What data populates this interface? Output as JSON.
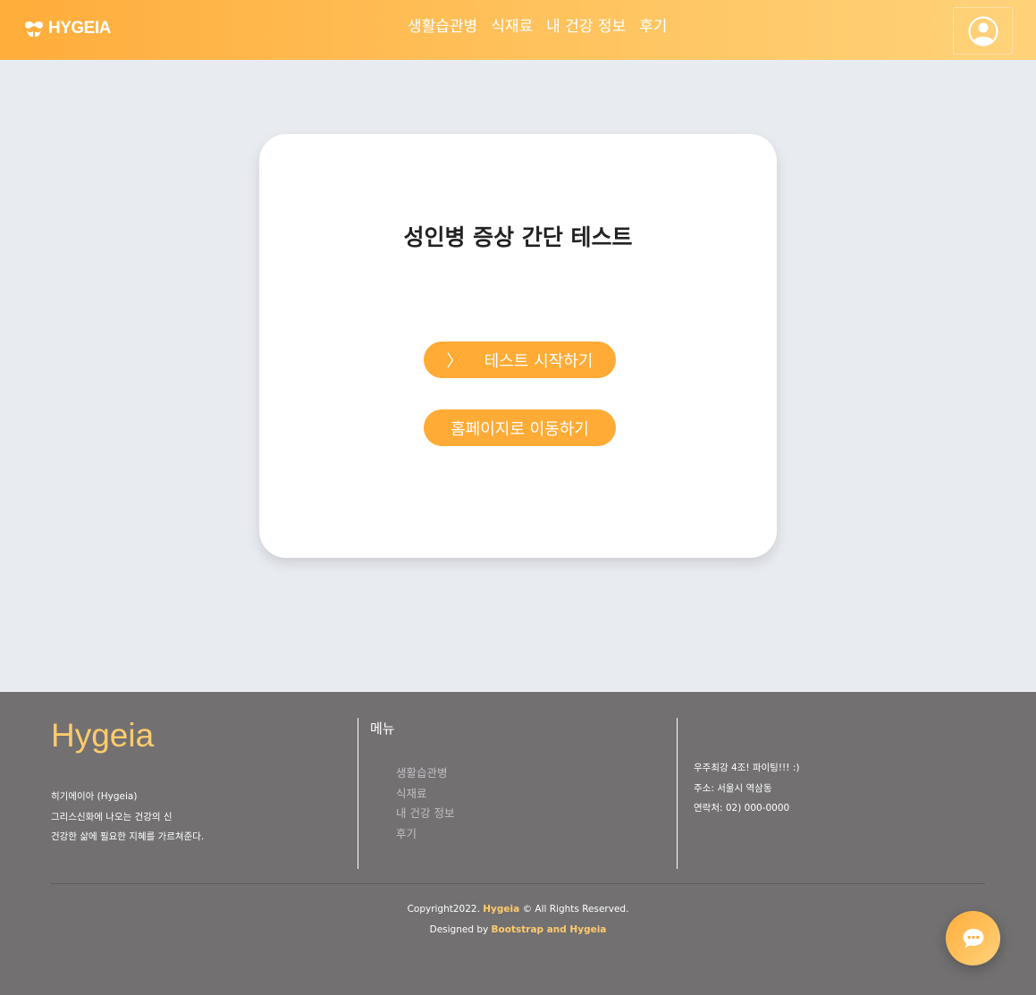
{
  "header": {
    "brand": "HYGEIA",
    "nav": [
      "생활습관병",
      "식재료",
      "내 건강 정보",
      "후기"
    ],
    "user_icon": "user-circle-icon"
  },
  "card": {
    "title": "성인병 증상 간단 테스트",
    "start_arrow": "〉",
    "start_label": "테스트 시작하기",
    "home_label": "홈페이지로 이동하기"
  },
  "footer": {
    "brand": "Hygeia",
    "desc": [
      "히기에이아 (Hygeia)",
      "그리스신화에 나오는 건강의 신",
      "건강한 삶에 필요한 지혜를 가르쳐준다."
    ],
    "menu_title": "메뉴",
    "menu": [
      "생활습관병",
      "식재료",
      "내 건강 정보",
      "후기"
    ],
    "contact": [
      "우주최강 4조! 파이팅!!! :)",
      "주소: 서울시 역삼동",
      "연락처: 02) 000-0000"
    ],
    "copyright_prefix": "Copyright2022. ",
    "copyright_brand": "Hygeia",
    "copyright_suffix": " © All Rights Reserved.",
    "designed_prefix": "Designed by ",
    "designed_by": "Bootstrap and Hygeia"
  },
  "chat_icon": "chat-bubble-icon",
  "colors": {
    "accent": "#ffab35",
    "header_start": "#ffad3b",
    "header_end": "#ffd27a",
    "footer_bg": "#727071",
    "footer_highlight": "#ffcb6b",
    "page_bg": "#e8ebf0"
  }
}
